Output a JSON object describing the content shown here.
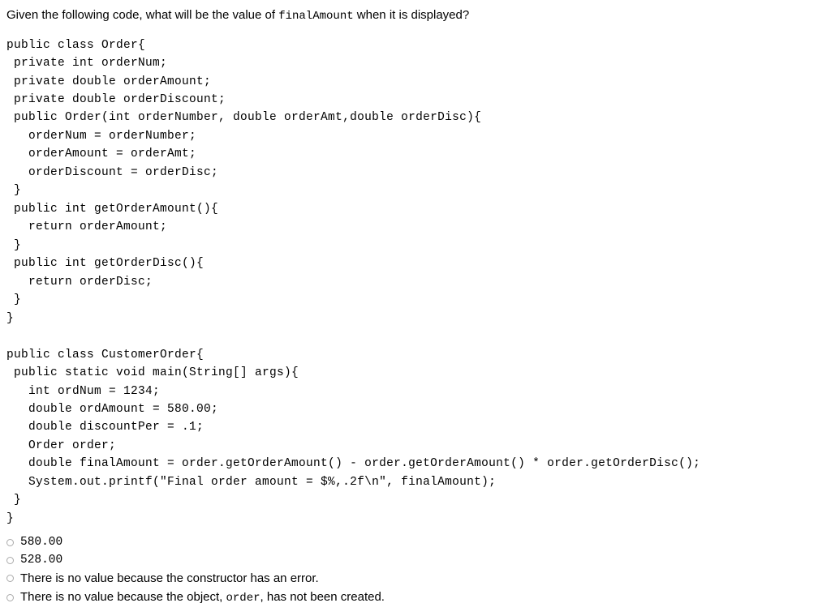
{
  "question": {
    "prefix": "Given the following code, what will be the value of ",
    "codeword": "finalAmount",
    "suffix": " when it is displayed?"
  },
  "code": "public class Order{\n private int orderNum;\n private double orderAmount;\n private double orderDiscount;\n public Order(int orderNumber, double orderAmt,double orderDisc){\n   orderNum = orderNumber;\n   orderAmount = orderAmt;\n   orderDiscount = orderDisc;\n }\n public int getOrderAmount(){\n   return orderAmount;\n }\n public int getOrderDisc(){\n   return orderDisc;\n }\n}\n\npublic class CustomerOrder{\n public static void main(String[] args){\n   int ordNum = 1234;\n   double ordAmount = 580.00;\n   double discountPer = .1;\n   Order order;\n   double finalAmount = order.getOrderAmount() - order.getOrderAmount() * order.getOrderDisc();\n   System.out.printf(\"Final order amount = $%,.2f\\n\", finalAmount);\n }\n}",
  "answers": [
    {
      "text": "580.00",
      "mono": true
    },
    {
      "text": "528.00",
      "mono": true
    },
    {
      "text": "There is no value because the constructor has an error.",
      "mono": false
    },
    {
      "prefix": "There is no value because the object, ",
      "code": "order",
      "suffix": ", has not been created.",
      "mono": false,
      "mixed": true
    }
  ]
}
